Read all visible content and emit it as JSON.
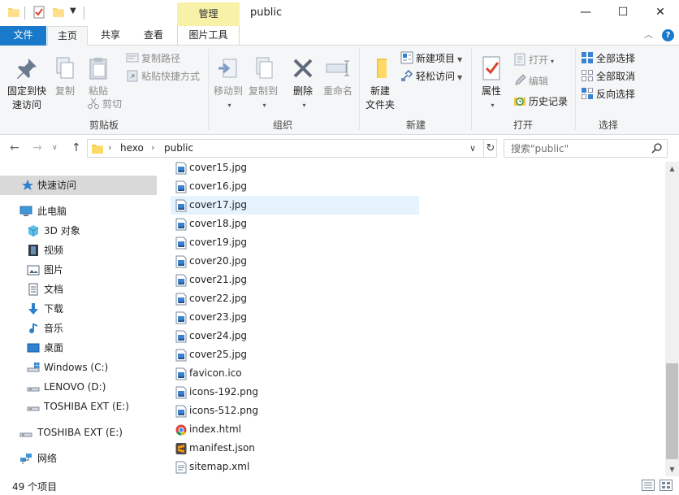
{
  "titlebar": {
    "title": "public",
    "contextual_tab": "管理",
    "controls": {
      "minimize": "—",
      "maximize": "☐",
      "close": "✕"
    }
  },
  "tabs": {
    "file": "文件",
    "home": "主页",
    "share": "共享",
    "view": "查看",
    "picture_tools": "图片工具"
  },
  "ribbon": {
    "clipboard": {
      "label": "剪贴板",
      "pin": "固定到快\n速访问",
      "copy": "复制",
      "paste": "粘贴",
      "copy_path": "复制路径",
      "paste_shortcut": "粘贴快捷方式",
      "cut": "剪切"
    },
    "organize": {
      "label": "组织",
      "move_to": "移动到",
      "copy_to": "复制到",
      "delete": "删除",
      "rename": "重命名"
    },
    "new": {
      "label": "新建",
      "new_folder": "新建\n文件夹",
      "new_item": "新建项目",
      "easy_access": "轻松访问"
    },
    "open": {
      "label": "打开",
      "properties": "属性",
      "open": "打开",
      "edit": "编辑",
      "history": "历史记录"
    },
    "select": {
      "label": "选择",
      "select_all": "全部选择",
      "select_none": "全部取消",
      "invert": "反向选择"
    }
  },
  "address": {
    "parts": [
      "hexo",
      "public"
    ],
    "search_placeholder": "搜索\"public\""
  },
  "navpane": {
    "quick_access": "快速访问",
    "this_pc": "此电脑",
    "objects3d": "3D 对象",
    "videos": "视频",
    "pictures": "图片",
    "documents": "文档",
    "downloads": "下载",
    "music": "音乐",
    "desktop": "桌面",
    "drive_c": "Windows (C:)",
    "drive_d": "LENOVO (D:)",
    "drive_e": "TOSHIBA EXT (E:)",
    "drive_e_root": "TOSHIBA EXT (E:)",
    "network": "网络"
  },
  "files": [
    {
      "name": "cover15.jpg",
      "icon": "image-file-icon"
    },
    {
      "name": "cover16.jpg",
      "icon": "image-file-icon"
    },
    {
      "name": "cover17.jpg",
      "icon": "image-file-icon"
    },
    {
      "name": "cover18.jpg",
      "icon": "image-file-icon"
    },
    {
      "name": "cover19.jpg",
      "icon": "image-file-icon"
    },
    {
      "name": "cover20.jpg",
      "icon": "image-file-icon"
    },
    {
      "name": "cover21.jpg",
      "icon": "image-file-icon"
    },
    {
      "name": "cover22.jpg",
      "icon": "image-file-icon"
    },
    {
      "name": "cover23.jpg",
      "icon": "image-file-icon"
    },
    {
      "name": "cover24.jpg",
      "icon": "image-file-icon"
    },
    {
      "name": "cover25.jpg",
      "icon": "image-file-icon"
    },
    {
      "name": "favicon.ico",
      "icon": "image-file-icon"
    },
    {
      "name": "icons-192.png",
      "icon": "image-file-icon"
    },
    {
      "name": "icons-512.png",
      "icon": "image-file-icon"
    },
    {
      "name": "index.html",
      "icon": "chrome-icon"
    },
    {
      "name": "manifest.json",
      "icon": "sublime-icon"
    },
    {
      "name": "sitemap.xml",
      "icon": "text-file-icon"
    }
  ],
  "status": {
    "item_count": "49 个项目"
  },
  "colors": {
    "accent": "#1979ca",
    "contextual_tab": "#f7f2a8",
    "hover_row": "#e5f3ff",
    "selected_nav": "#d9d9d9"
  }
}
